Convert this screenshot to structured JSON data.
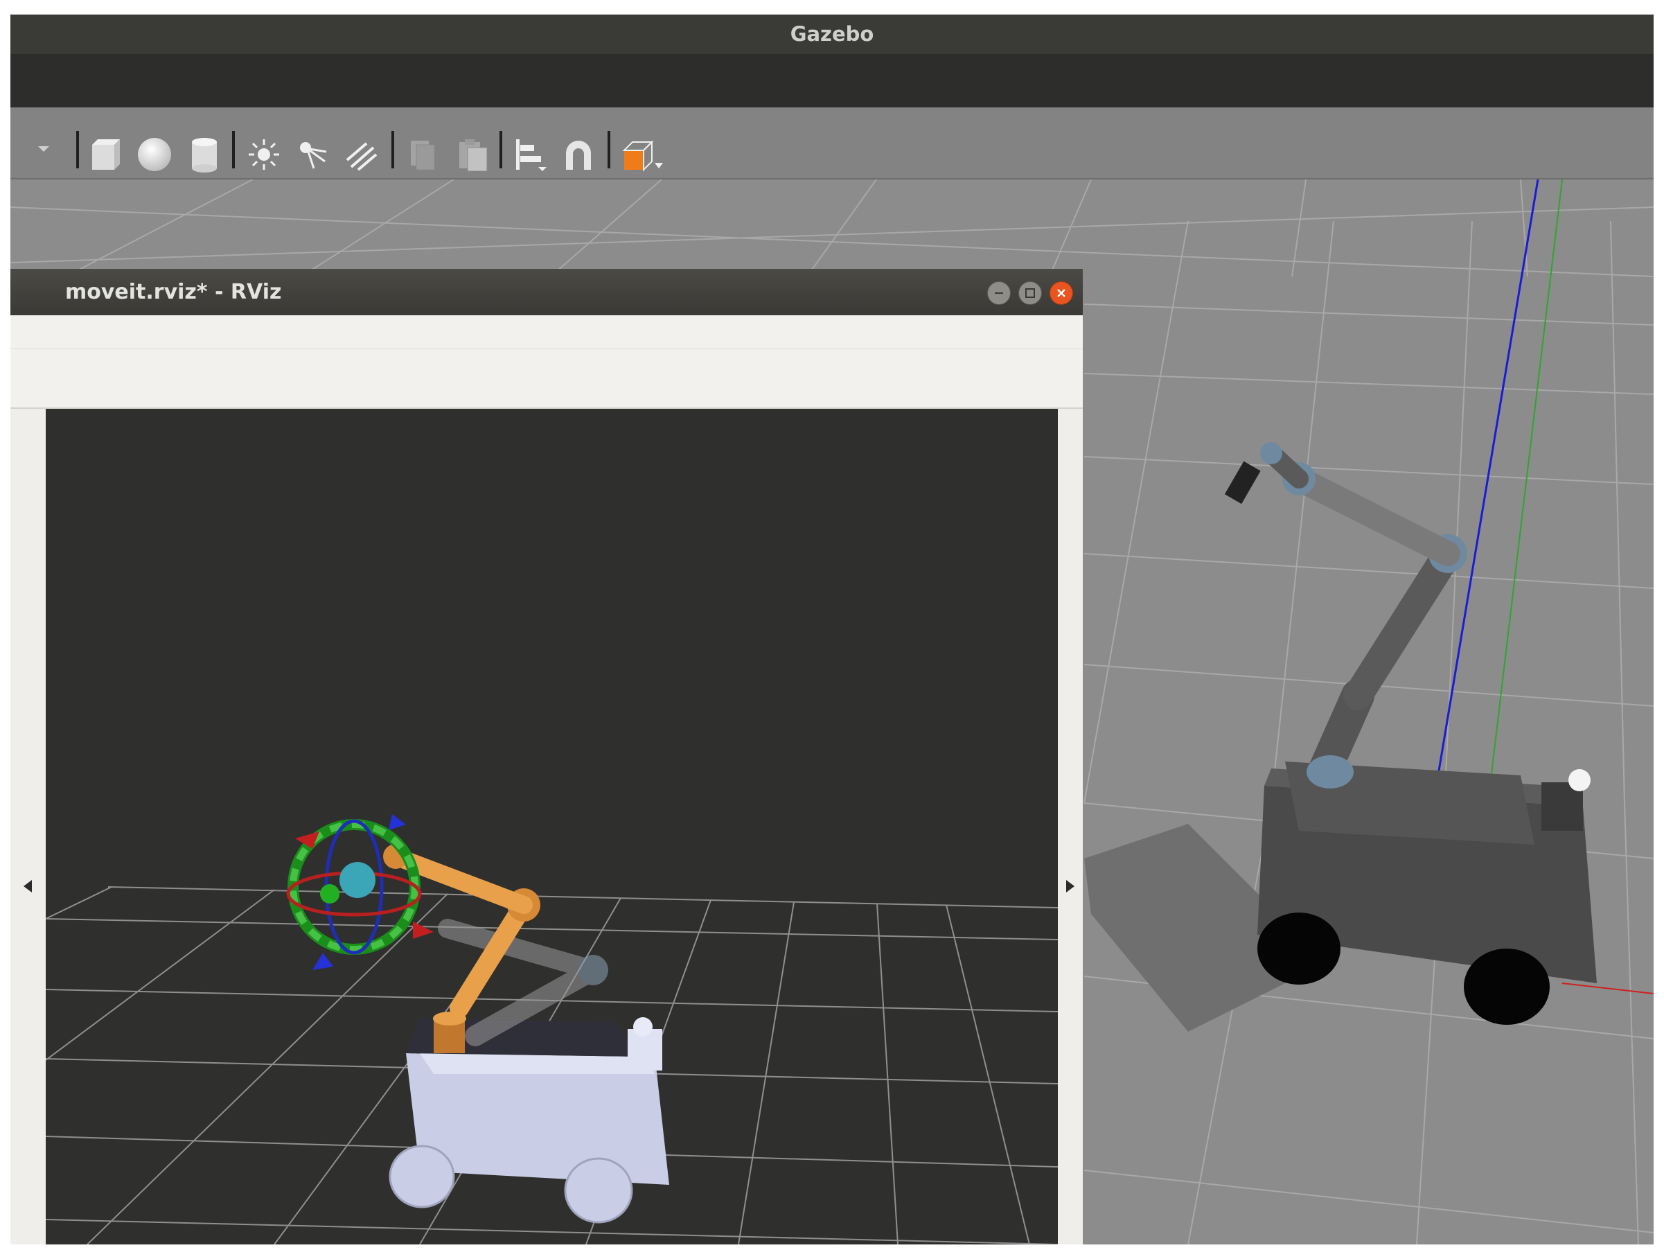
{
  "gazebo": {
    "title": "Gazebo",
    "toolbar": {
      "items": [
        "dropdown-arrow-icon",
        "box-icon",
        "sphere-icon",
        "cylinder-icon",
        "point-light-icon",
        "spot-light-icon",
        "directional-light-icon",
        "copy-icon",
        "paste-icon",
        "align-icon",
        "snap-icon",
        "view-angle-icon"
      ]
    }
  },
  "rviz": {
    "title": "moveit.rviz* - RViz",
    "buttons": [
      "minimize",
      "maximize",
      "close"
    ],
    "colors": {
      "close": "#e95420",
      "arm": "#e8a04b",
      "base": "#c9cde6",
      "grid": "#8f8f8f"
    }
  }
}
